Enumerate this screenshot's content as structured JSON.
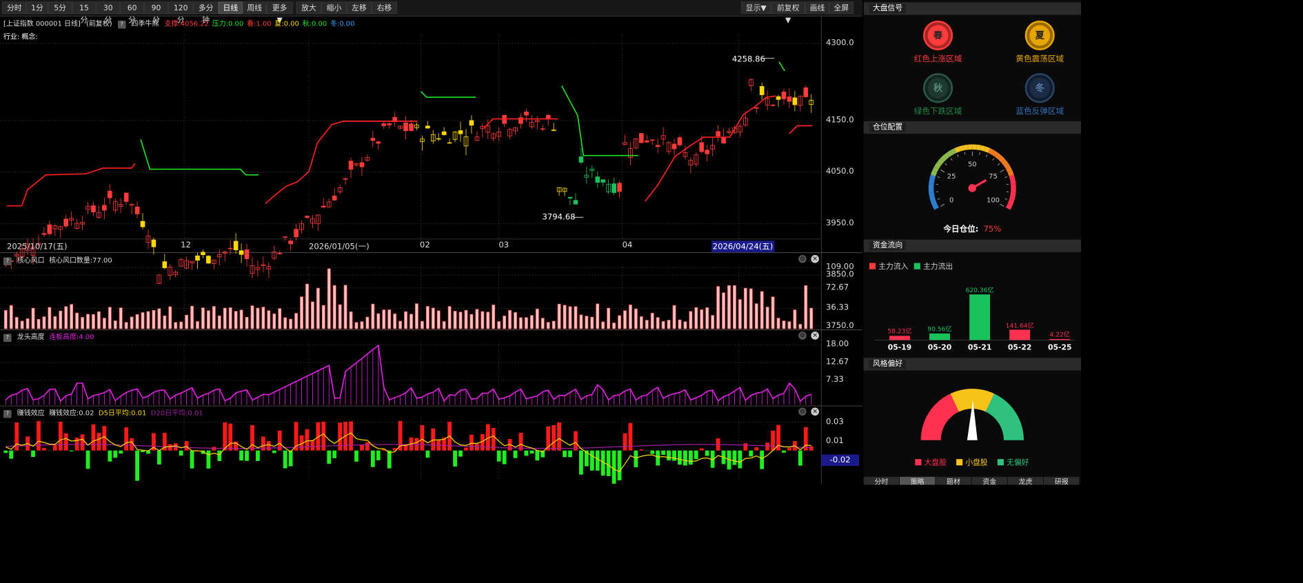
{
  "toolbar": {
    "periods": [
      "分时",
      "1分",
      "5分",
      "15分",
      "30分",
      "60分",
      "90分",
      "120分",
      "多分钟",
      "日线",
      "周线",
      "更多▼"
    ],
    "actions": [
      "放大",
      "缩小",
      "左移",
      "右移"
    ],
    "right": [
      "显示▼",
      "前复权▼",
      "画线",
      "全屏"
    ],
    "active": "日线"
  },
  "main": {
    "title": "[上证指数 000001 日线]",
    "fq": "(前复权)",
    "indicator": "四季牛熊",
    "support": "支撑:4056.22",
    "pressure": "压力:0.00",
    "spring": "春:1.00",
    "summer": "夏:0.00",
    "autumn": "秋:0.00",
    "winter": "冬:0.00",
    "industry": "行业: 概念:",
    "high_label": "4258.86",
    "low_label": "3794.68",
    "y_ticks": [
      "4300.0",
      "4150.0",
      "4050.0",
      "3950.0",
      "3850.0",
      "3750.0"
    ],
    "dates": [
      "2025/10/17(五)",
      "12",
      "2026/01/05(一)",
      "02",
      "03",
      "04",
      "2026/04/24(五)"
    ]
  },
  "panel1": {
    "name": "核心风口",
    "value": "核心风口数量:77.00",
    "ticks": [
      "109.00",
      "72.67",
      "36.33"
    ]
  },
  "panel2": {
    "name": "龙头高度",
    "value": "连板高度:4.00",
    "ticks": [
      "18.00",
      "12.67",
      "7.33"
    ]
  },
  "panel3": {
    "name": "赚钱效应",
    "value": "赚钱效应:0.02",
    "d5": "D5日平均:0.01",
    "d20": "D20日平均:0.01",
    "ticks": [
      "0.03",
      "0.01"
    ],
    "current": "-0.02"
  },
  "right": {
    "signals_title": "大盘信号",
    "signals": [
      {
        "icon": "春",
        "label": "红色上涨区域",
        "color": "#ff3b3b"
      },
      {
        "icon": "夏",
        "label": "黄色震荡区域",
        "color": "#e8a400"
      },
      {
        "icon": "秋",
        "label": "绿色下跌区域",
        "color": "#1e8a4a"
      },
      {
        "icon": "冬",
        "label": "蓝色反弹区域",
        "color": "#2f6fb8"
      }
    ],
    "position_title": "仓位配置",
    "gauge_ticks": [
      "0",
      "25",
      "50",
      "75",
      "100"
    ],
    "position_label": "今日仓位:",
    "position_value": "75%",
    "position_level": 0.75,
    "flow_title": "资金流向",
    "flow_in": "主力流入",
    "flow_out": "主力流出",
    "flows": [
      {
        "date": "05-19",
        "value": "58.23亿",
        "dir": "in",
        "amount": 58.23
      },
      {
        "date": "05-20",
        "value": "90.56亿",
        "dir": "out",
        "amount": 90.56
      },
      {
        "date": "05-21",
        "value": "620.36亿",
        "dir": "out",
        "amount": 620.36
      },
      {
        "date": "05-22",
        "value": "141.64亿",
        "dir": "in",
        "amount": 141.64
      },
      {
        "date": "05-25",
        "value": "4.22亿",
        "dir": "in",
        "amount": 4.22
      }
    ],
    "style_title": "风格偏好",
    "style_legend": [
      "大盘股",
      "小盘股",
      "无偏好"
    ],
    "bottom_tabs": [
      "分时",
      "策略",
      "题材",
      "资金",
      "龙虎",
      "研报"
    ]
  }
}
